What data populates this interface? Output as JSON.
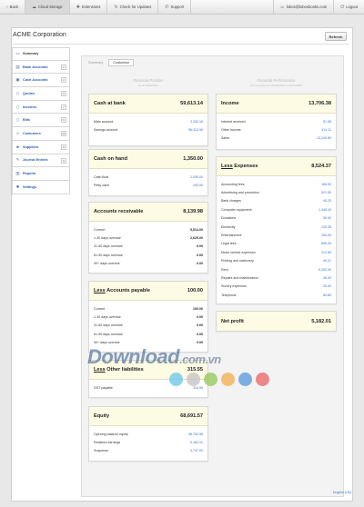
{
  "topbar": {
    "back": "Back",
    "cloud_storage": "Cloud Storage",
    "extensions": "Extensions",
    "check_updates": "Check for Updates",
    "support": "Support",
    "email": "lobos@lobosbooks.com",
    "logout": "Logout"
  },
  "company": "ACME Corporation",
  "refresh": "Refresh",
  "sidebar": {
    "items": [
      {
        "label": "Summary",
        "badge": ""
      },
      {
        "label": "Bank Accounts",
        "badge": "2"
      },
      {
        "label": "Cash Accounts",
        "badge": "2"
      },
      {
        "label": "Quotes",
        "badge": "0"
      },
      {
        "label": "Invoices",
        "badge": "7"
      },
      {
        "label": "Bills",
        "badge": "6"
      },
      {
        "label": "Customers",
        "badge": "12"
      },
      {
        "label": "Suppliers",
        "badge": "9"
      },
      {
        "label": "Journal Entries",
        "badge": "9"
      },
      {
        "label": "Reports",
        "badge": ""
      },
      {
        "label": "Settings",
        "badge": ""
      }
    ]
  },
  "tabs": [
    "Summary",
    "Customise"
  ],
  "headers": {
    "left_title": "Financial Position",
    "left_sub": "as at 31/03/2012",
    "right_title": "Financial Performance",
    "right_sub": "For the period of 01/10/2012 to 31/03/2012"
  },
  "cards": {
    "cash_at_bank": {
      "title": "Cash at bank",
      "total": "59,613.14",
      "rows": [
        {
          "label": "Main account",
          "value": "3,200.18"
        },
        {
          "label": "Savings account",
          "value": "56,412.96"
        }
      ]
    },
    "cash_on_hand": {
      "title": "Cash on hand",
      "total": "1,350.00",
      "rows": [
        {
          "label": "Cash float",
          "value": "1,250.00"
        },
        {
          "label": "Petty cash",
          "value": "100.00"
        }
      ]
    },
    "receivable": {
      "title": "Accounts receivable",
      "total": "8,139.98",
      "rows": [
        {
          "label": "Current",
          "value": "5,514.00"
        },
        {
          "label": "1-30 days overdue",
          "value": "2,625.00"
        },
        {
          "label": "31-60 days overdue",
          "value": "0.00"
        },
        {
          "label": "61-90 days overdue",
          "value": "0.00"
        },
        {
          "label": "90+ days overdue",
          "value": "0.00"
        }
      ]
    },
    "payable": {
      "title_prefix": "Less",
      "title": " Accounts payable",
      "total": "100.00",
      "rows": [
        {
          "label": "Current",
          "value": "100.00"
        },
        {
          "label": "1-30 days overdue",
          "value": "0.00"
        },
        {
          "label": "31-60 days overdue",
          "value": "0.00"
        },
        {
          "label": "61-90 days overdue",
          "value": "0.00"
        },
        {
          "label": "90+ days overdue",
          "value": "0.00"
        }
      ]
    },
    "other_liabilities": {
      "title_prefix": "Less",
      "title": " Other liabilities",
      "total": "315.55",
      "rows": [
        {
          "label": "GST payable",
          "value": "315.55"
        }
      ]
    },
    "equity": {
      "title": "Equity",
      "total": "68,691.57",
      "rows": [
        {
          "label": "Opening balance equity",
          "value": "58,762.56"
        },
        {
          "label": "Retained earnings",
          "value": "5,182.01"
        },
        {
          "label": "Suspense",
          "value": "4,747.00"
        }
      ]
    },
    "income": {
      "title": "Income",
      "total": "13,706.38",
      "rows": [
        {
          "label": "Interest received",
          "value": "51.38"
        },
        {
          "label": "Other income",
          "value": "414.11"
        },
        {
          "label": "Sales",
          "value": "13,240.89"
        }
      ]
    },
    "expenses": {
      "title_prefix": "Less",
      "title": " Expenses",
      "total": "8,524.37",
      "rows": [
        {
          "label": "Accounting fees",
          "value": "165.00"
        },
        {
          "label": "Advertising and promotion",
          "value": "521.50"
        },
        {
          "label": "Bank charges",
          "value": "40.20"
        },
        {
          "label": "Computer equipment",
          "value": "1,345.43"
        },
        {
          "label": "Donations",
          "value": "50.00"
        },
        {
          "label": "Electricity",
          "value": "120.25"
        },
        {
          "label": "Entertainment",
          "value": "254.00"
        },
        {
          "label": "Legal fees",
          "value": "650.00"
        },
        {
          "label": "Motor vehicle expenses",
          "value": "212.89"
        },
        {
          "label": "Printing and stationery",
          "value": "40.21"
        },
        {
          "label": "Rent",
          "value": "5,200.00"
        },
        {
          "label": "Repairs and maintenance",
          "value": "30.00"
        },
        {
          "label": "Sundry expenses",
          "value": "-30.00"
        },
        {
          "label": "Telephone",
          "value": "89.89"
        }
      ]
    },
    "net_profit": {
      "title": "Net profit",
      "total": "5,182.01"
    }
  },
  "watermark": {
    "main": "Download",
    "suffix": ".com.vn"
  },
  "footer_link": "English (UK)",
  "colors": {
    "card_header": "#fdfbe3",
    "link": "#3a6fc4",
    "dots": [
      "#5bc0eb",
      "#bdbdbd",
      "#8bc34a",
      "#f4a742",
      "#4a90d9",
      "#e85a5a"
    ]
  }
}
